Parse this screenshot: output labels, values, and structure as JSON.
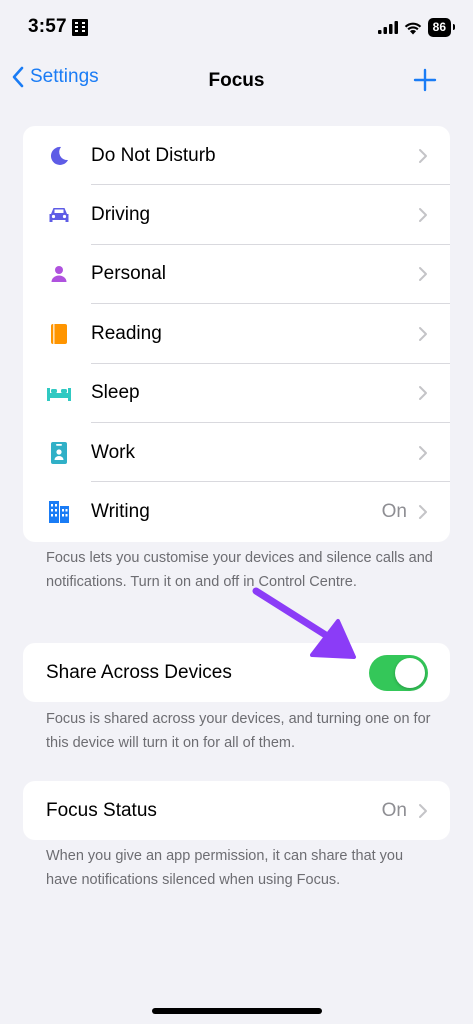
{
  "status_bar": {
    "time": "3:57",
    "battery": "86"
  },
  "nav": {
    "back_label": "Settings",
    "title": "Focus"
  },
  "focus_modes": [
    {
      "label": "Do Not Disturb",
      "value": "",
      "icon": "moon-icon",
      "color": "#5e5ce6"
    },
    {
      "label": "Driving",
      "value": "",
      "icon": "car-icon",
      "color": "#5e5ce6"
    },
    {
      "label": "Personal",
      "value": "",
      "icon": "person-icon",
      "color": "#af52de"
    },
    {
      "label": "Reading",
      "value": "",
      "icon": "book-icon",
      "color": "#ff9500"
    },
    {
      "label": "Sleep",
      "value": "",
      "icon": "bed-icon",
      "color": "#30c9c2"
    },
    {
      "label": "Work",
      "value": "",
      "icon": "id-badge-icon",
      "color": "#30b0c7"
    },
    {
      "label": "Writing",
      "value": "On",
      "icon": "building-icon",
      "color": "#1a7cf5"
    }
  ],
  "focus_note": "Focus lets you customise your devices and silence calls and notifications. Turn it on and off in Control Centre.",
  "share": {
    "label": "Share Across Devices",
    "enabled": true,
    "note": "Focus is shared across your devices, and turning one on for this device will turn it on for all of them."
  },
  "status": {
    "label": "Focus Status",
    "value": "On",
    "note": "When you give an app permission, it can share that you have notifications silenced when using Focus."
  },
  "colors": {
    "accent": "#1a7cf5",
    "toggle_on": "#34c759",
    "annotation_arrow": "#8b3cf7"
  }
}
